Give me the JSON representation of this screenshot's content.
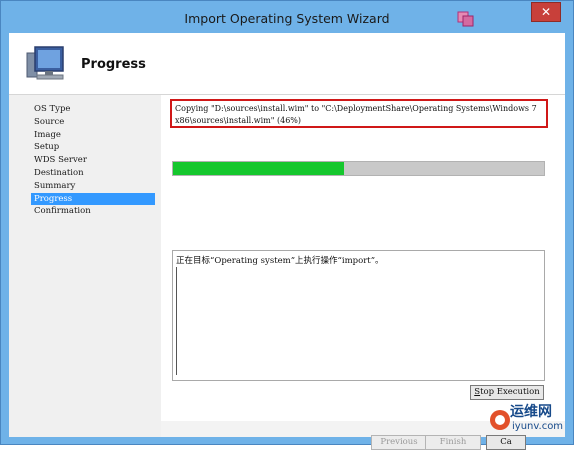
{
  "window": {
    "title": "Import Operating System Wizard",
    "close_label": "✕"
  },
  "header": {
    "title": "Progress"
  },
  "nav": {
    "items": [
      "OS Type",
      "Source",
      "Image",
      "Setup",
      "WDS Server",
      "Destination",
      "Summary",
      "Progress",
      "Confirmation"
    ],
    "active": "Progress"
  },
  "copy_status": "Copying \"D:\\sources\\install.wim\" to \"C:\\DeploymentShare\\Operating Systems\\Windows 7 x86\\sources\\install.wim\" (46%)",
  "progress": {
    "percent": 46,
    "fill_color": "#15c72d"
  },
  "log": {
    "text": "正在目标“Operating system”上执行操作“import”。"
  },
  "buttons": {
    "stop": {
      "label": "Stop Execution",
      "accel": "S"
    },
    "previous": {
      "label": "Previous"
    },
    "finish": {
      "label": "Finish"
    },
    "cancel": {
      "label": "Ca"
    }
  },
  "watermark": {
    "brand_cn": "运维网",
    "brand_en": "iyunv.com"
  },
  "colors": {
    "title_bar": "#6fb2e8",
    "nav_active": "#3399ff",
    "highlight_border": "#d01818"
  }
}
